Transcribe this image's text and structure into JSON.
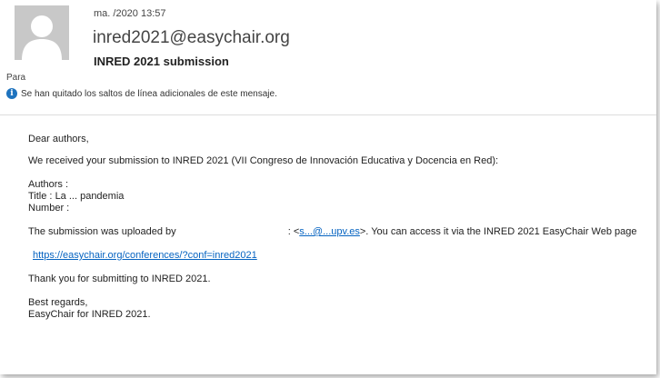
{
  "header": {
    "date": "ma.  /2020 13:57",
    "sender": "inred2021@easychair.org",
    "subject": "INRED 2021 submission",
    "to_label": "Para",
    "info_text": "Se han quitado los saltos de línea adicionales de este mensaje."
  },
  "body": {
    "greeting": "Dear authors,",
    "received": "We received your submission to INRED 2021 (VII Congreso de Innovación Educativa y Docencia en Red):",
    "authors_label": "Authors :",
    "title_label": "Title :",
    "title_value": "La ... pandemia",
    "number_label": "Number :",
    "uploaded_prefix": "The submission was uploaded by",
    "uploaded_email": "s...@...upv.es",
    "uploaded_suffix": ">. You can access it via the INRED 2021 EasyChair Web page",
    "conference_link": "https://easychair.org/conferences/?conf=inred2021",
    "thanks": "Thank you for submitting to INRED 2021.",
    "regards": "Best regards,",
    "signature": "EasyChair for INRED 2021."
  },
  "colors": {
    "link": "#0563c1",
    "info_icon": "#1e73be"
  },
  "icons": {
    "avatar": "avatar-placeholder-icon",
    "info": "info-icon"
  }
}
